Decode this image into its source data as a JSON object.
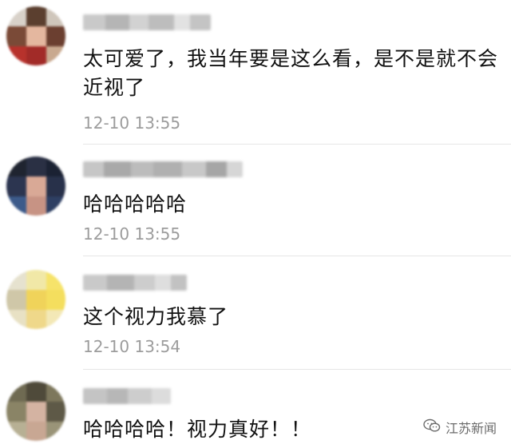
{
  "comments": [
    {
      "text": "太可爱了，我当年要是这么看，是不是就不会近视了",
      "timestamp": "12-10 13:55"
    },
    {
      "text": "哈哈哈哈哈",
      "timestamp": "12-10 13:55"
    },
    {
      "text": "这个视力我慕了",
      "timestamp": "12-10 13:54"
    },
    {
      "text": "哈哈哈哈！视力真好！！",
      "timestamp": ""
    }
  ],
  "watermark": {
    "label": "江苏新闻",
    "icon": "wechat-icon"
  },
  "colors": {
    "text": "#111111",
    "timestamp": "#9c9c9c",
    "divider": "#e6e6e6"
  }
}
